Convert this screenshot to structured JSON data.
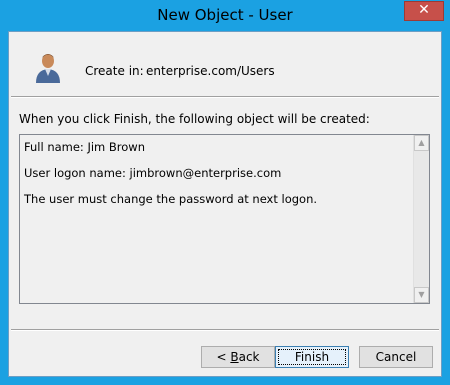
{
  "window": {
    "title": "New Object - User",
    "close_glyph": "✕"
  },
  "header": {
    "icon": "user-icon",
    "create_in_label": "Create in:",
    "create_in_value": "enterprise.com/Users"
  },
  "main": {
    "intro_text": "When you click Finish, the following object will be created:",
    "summary_lines": [
      "Full name: Jim Brown",
      "User logon name: jimbrown@enterprise.com",
      "The user must change the password at next logon."
    ]
  },
  "buttons": {
    "back_prefix": "< ",
    "back_mnemonic": "B",
    "back_rest": "ack",
    "finish": "Finish",
    "cancel": "Cancel"
  }
}
